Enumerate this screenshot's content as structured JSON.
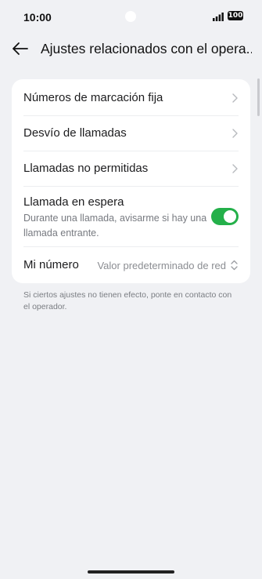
{
  "status_bar": {
    "time": "10:00",
    "battery": "100"
  },
  "header": {
    "title": "Ajustes relacionados con el opera..."
  },
  "settings": {
    "fixed_dialing": "Números de marcación fija",
    "call_forwarding": "Desvío de llamadas",
    "call_barring": "Llamadas no permitidas",
    "call_waiting": {
      "label": "Llamada en espera",
      "description": "Durante una llamada, avisarme si hay una llamada entrante.",
      "enabled": true
    },
    "my_number": {
      "label": "Mi número",
      "value": "Valor predeterminado de red"
    }
  },
  "footer_note": "Si ciertos ajustes no tienen efecto, ponte en contacto con el operador.",
  "colors": {
    "toggle_on": "#24b04a",
    "background": "#f0f1f4"
  }
}
